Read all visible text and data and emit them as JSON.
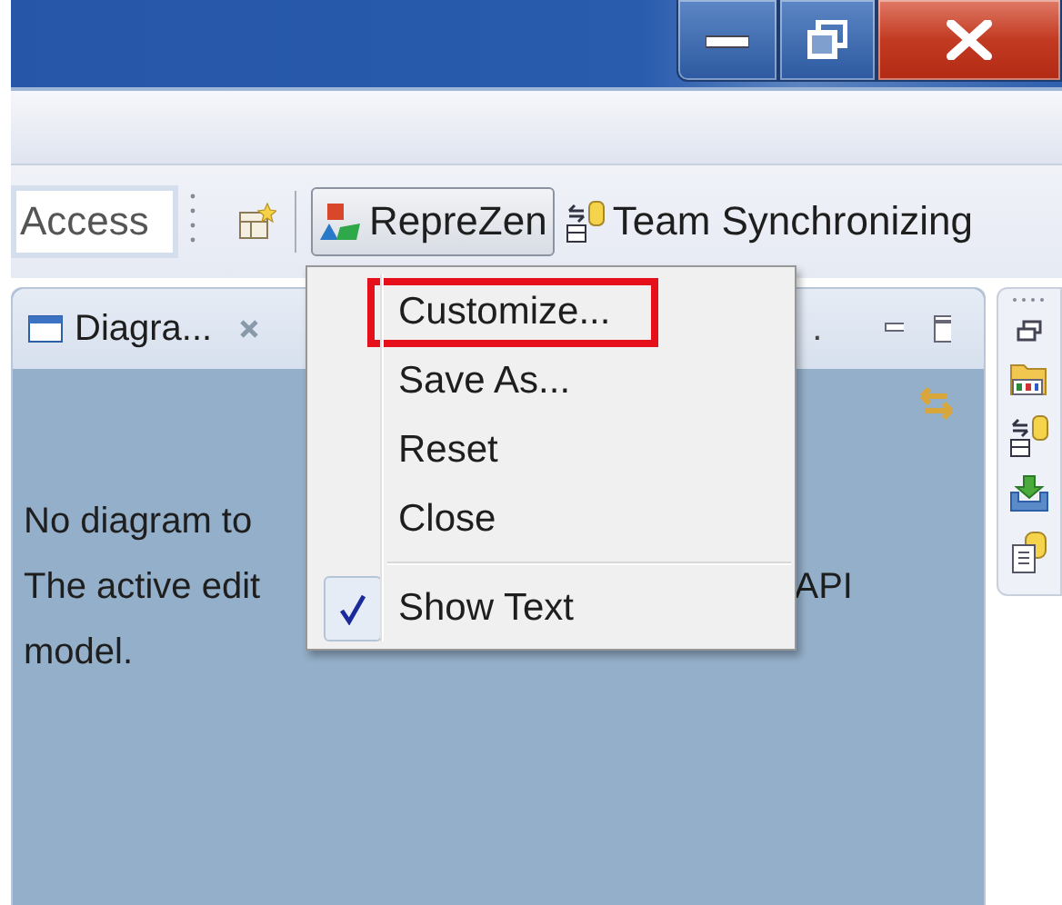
{
  "toolbar": {
    "quick_access": {
      "value": "Access"
    },
    "perspectives": [
      {
        "label": "RepreZen",
        "selected": true
      },
      {
        "label": "Team Synchronizing",
        "selected": false
      }
    ]
  },
  "panel": {
    "tabs": [
      {
        "title": "Diagra...",
        "selected": true
      },
      {
        "title": ".",
        "selected": false
      }
    ],
    "message": [
      {
        "parts": [
          "No diagram to"
        ]
      },
      {
        "parts": [
          "The active edit",
          "API"
        ]
      },
      {
        "parts": [
          "model."
        ]
      }
    ]
  },
  "menu": {
    "items": [
      {
        "kind": "item",
        "label": "Customize...",
        "highlighted": true,
        "checked": false
      },
      {
        "kind": "item",
        "label": "Save As...",
        "highlighted": false,
        "checked": false
      },
      {
        "kind": "item",
        "label": "Reset",
        "highlighted": false,
        "checked": false
      },
      {
        "kind": "item",
        "label": "Close",
        "highlighted": false,
        "checked": false
      },
      {
        "kind": "separator"
      },
      {
        "kind": "item",
        "label": "Show Text",
        "highlighted": false,
        "checked": true
      }
    ]
  }
}
